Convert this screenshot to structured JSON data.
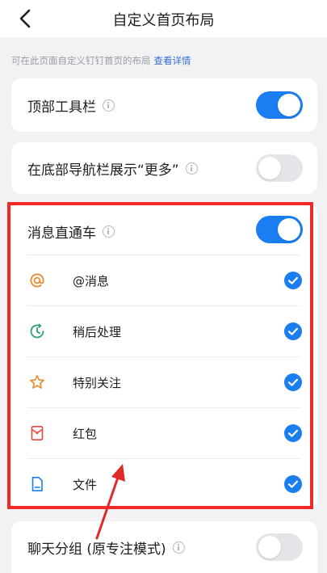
{
  "header": {
    "title": "自定义首页布局"
  },
  "hint": {
    "text": "可在此页面自定义钉钉首页的布局",
    "link": "查看详情"
  },
  "settings": {
    "toolbar": {
      "label": "顶部工具栏",
      "enabled": true
    },
    "more_nav": {
      "label": "在底部导航栏展示“更多”",
      "enabled": false
    },
    "direct": {
      "label": "消息直通车",
      "enabled": true
    },
    "chat_groups": {
      "label": "聊天分组 (原专注模式)",
      "enabled": false
    }
  },
  "direct_items": [
    {
      "label": "@消息",
      "icon": "at-icon",
      "checked": true
    },
    {
      "label": "稍后处理",
      "icon": "clock-icon",
      "checked": true
    },
    {
      "label": "特别关注",
      "icon": "star-icon",
      "checked": true
    },
    {
      "label": "红包",
      "icon": "red-packet-icon",
      "checked": true
    },
    {
      "label": "文件",
      "icon": "file-icon",
      "checked": true
    }
  ],
  "colors": {
    "accent": "#1a7df0",
    "highlight": "#ee2b2b",
    "toggle_off": "#e4e5e8",
    "link": "#3370d6"
  }
}
